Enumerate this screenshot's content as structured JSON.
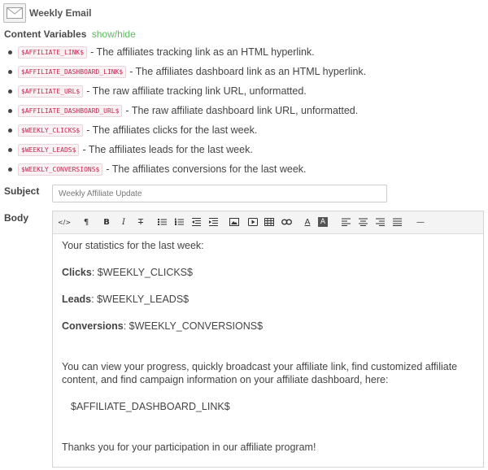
{
  "header": {
    "title": "Weekly Email",
    "icon": "envelope-icon"
  },
  "content_variables": {
    "label": "Content Variables",
    "toggle": "show/hide",
    "items": [
      {
        "code": "$AFFILIATE_LINK$",
        "desc": "- The affiliates tracking link as an HTML hyperlink."
      },
      {
        "code": "$AFFILIATE_DASHBOARD_LINK$",
        "desc": "- The affiliates dashboard link as an HTML hyperlink."
      },
      {
        "code": "$AFFILIATE_URL$",
        "desc": "- The raw affiliate tracking link URL, unformatted."
      },
      {
        "code": "$AFFILIATE_DASHBOARD_URL$",
        "desc": "- The raw affiliate dashboard link URL, unformatted."
      },
      {
        "code": "$WEEKLY_CLICKS$",
        "desc": "- The affiliates clicks for the last week."
      },
      {
        "code": "$WEEKLY_LEADS$",
        "desc": "- The affiliates leads for the last week."
      },
      {
        "code": "$WEEKLY_CONVERSIONS$",
        "desc": "- The affiliates conversions for the last week."
      }
    ]
  },
  "subject": {
    "label": "Subject",
    "value": "Weekly Affiliate Update"
  },
  "body": {
    "label": "Body",
    "toolbar": {
      "html": "</>",
      "paragraph": "¶",
      "bold": "B",
      "italic": "I",
      "strike": "T",
      "font_color": "A",
      "back_color": "A",
      "hr": "—"
    },
    "intro": "Your statistics for the last week:",
    "clicks_label": "Clicks",
    "clicks_value": ": $WEEKLY_CLICKS$",
    "leads_label": "Leads",
    "leads_value": ": $WEEKLY_LEADS$",
    "conversions_label": "Conversions",
    "conversions_value": ": $WEEKLY_CONVERSIONS$",
    "progress_text": "You can view your progress, quickly broadcast your affiliate link, find customized affiliate content, and find campaign information on your affiliate dashboard, here:",
    "dashboard_link": "$AFFILIATE_DASHBOARD_LINK$",
    "thanks": "Thanks you for your participation in our affiliate program!"
  }
}
